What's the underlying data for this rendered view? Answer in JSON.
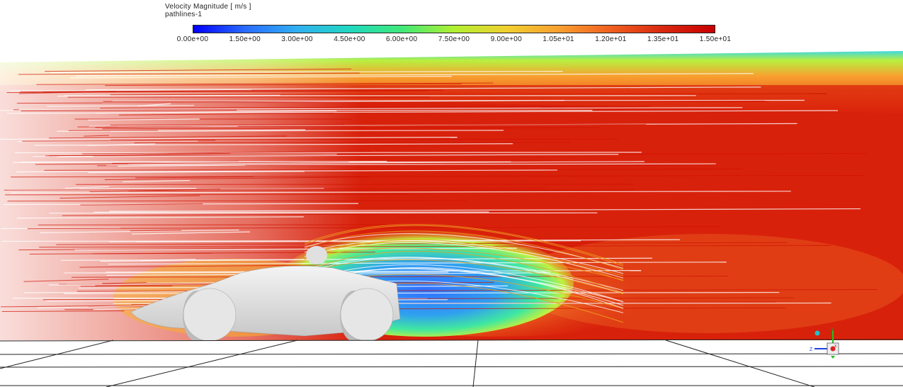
{
  "legend": {
    "title": "Velocity Magnitude [ m/s ]",
    "subtitle": "pathlines-1",
    "min": 0,
    "max": 15,
    "ticks": [
      "0.00e+00",
      "1.50e+00",
      "3.00e+00",
      "4.50e+00",
      "6.00e+00",
      "7.50e+00",
      "9.00e+00",
      "1.05e+01",
      "1.20e+01",
      "1.35e+01",
      "1.50e+01"
    ],
    "colors": [
      "#0000ff",
      "#2a6cff",
      "#30b0f0",
      "#20d8c0",
      "#40e878",
      "#b0f030",
      "#f0d030",
      "#f8a030",
      "#f06020",
      "#d82810",
      "#c80000"
    ]
  },
  "triad": {
    "x_label": "X",
    "y_label": "Y",
    "z_label": "Z"
  }
}
